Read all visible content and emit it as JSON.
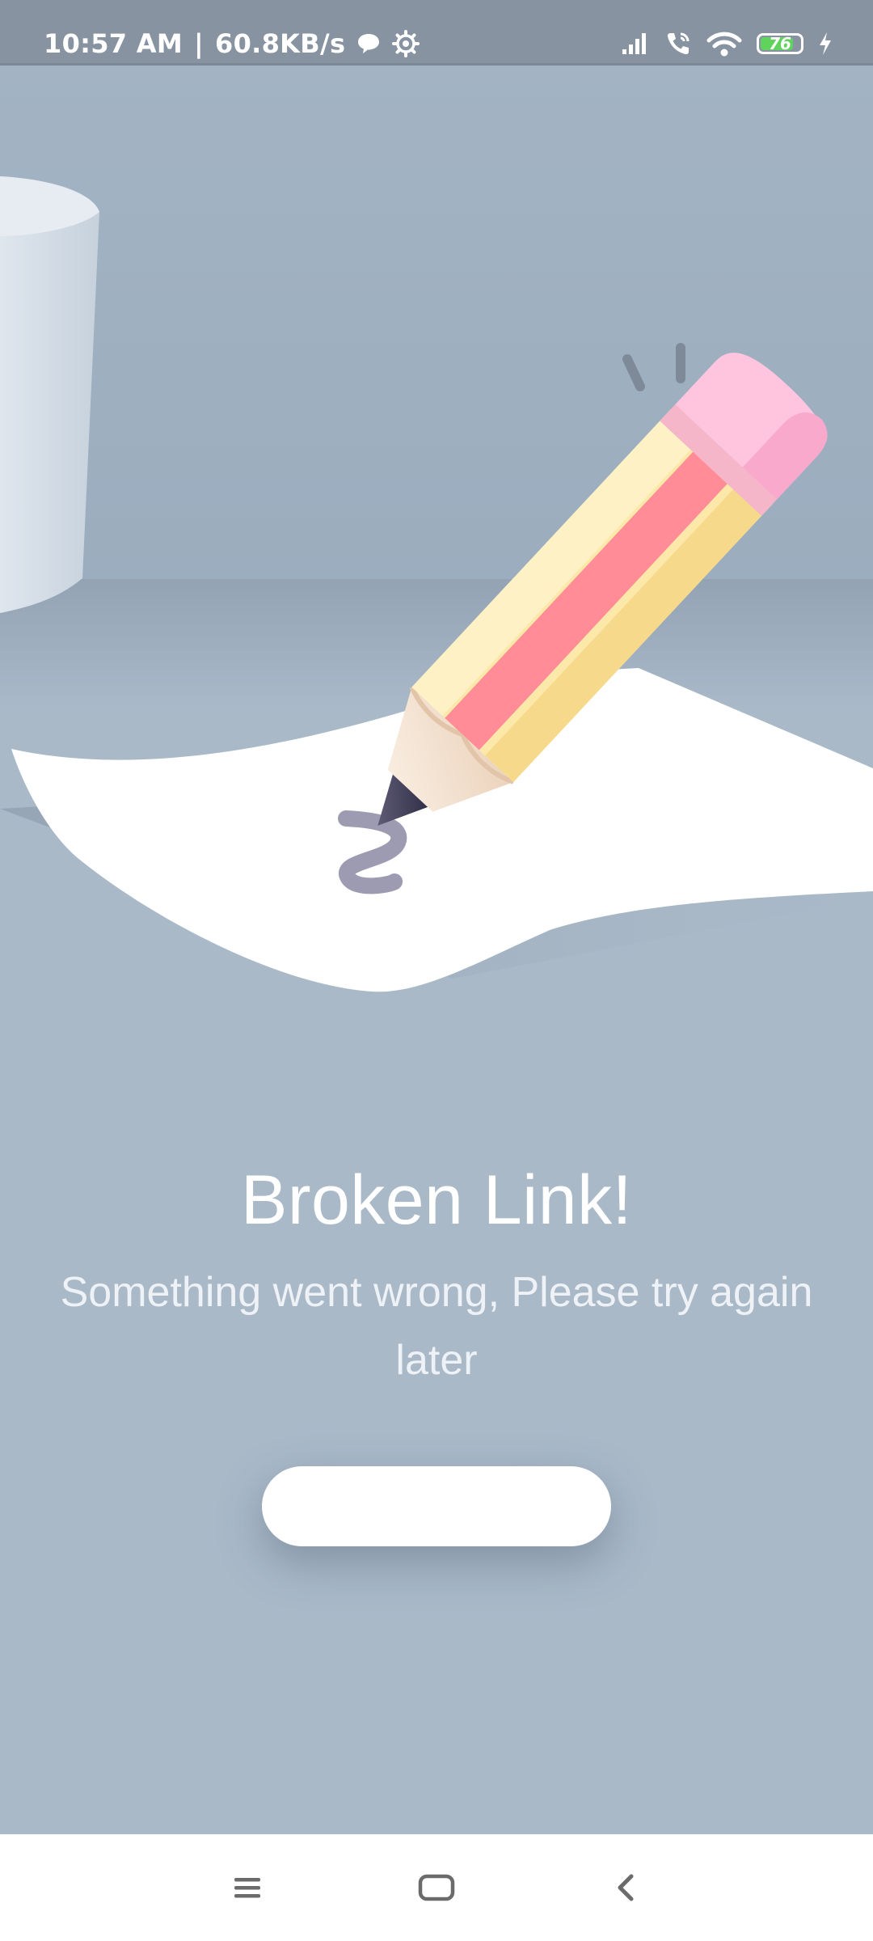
{
  "status_bar": {
    "time": "10:57 AM",
    "separator": "|",
    "speed": "60.8KB/s",
    "battery_level": "76",
    "icons": [
      "chat-bubble-icon",
      "gear-icon",
      "signal-icon",
      "wifi-calling-icon",
      "wifi-icon",
      "battery-icon",
      "charging-icon"
    ]
  },
  "error": {
    "title": "Broken Link!",
    "message": "Something went wrong, Please try again later"
  },
  "action_button": {
    "label": ""
  },
  "nav_bar": {
    "buttons": [
      "menu-icon",
      "home-icon",
      "back-icon"
    ]
  },
  "colors": {
    "background": "#a9b9c8",
    "status_bar": "#8793a0",
    "battery_fill": "#5fd35c",
    "button": "#ffffff"
  }
}
